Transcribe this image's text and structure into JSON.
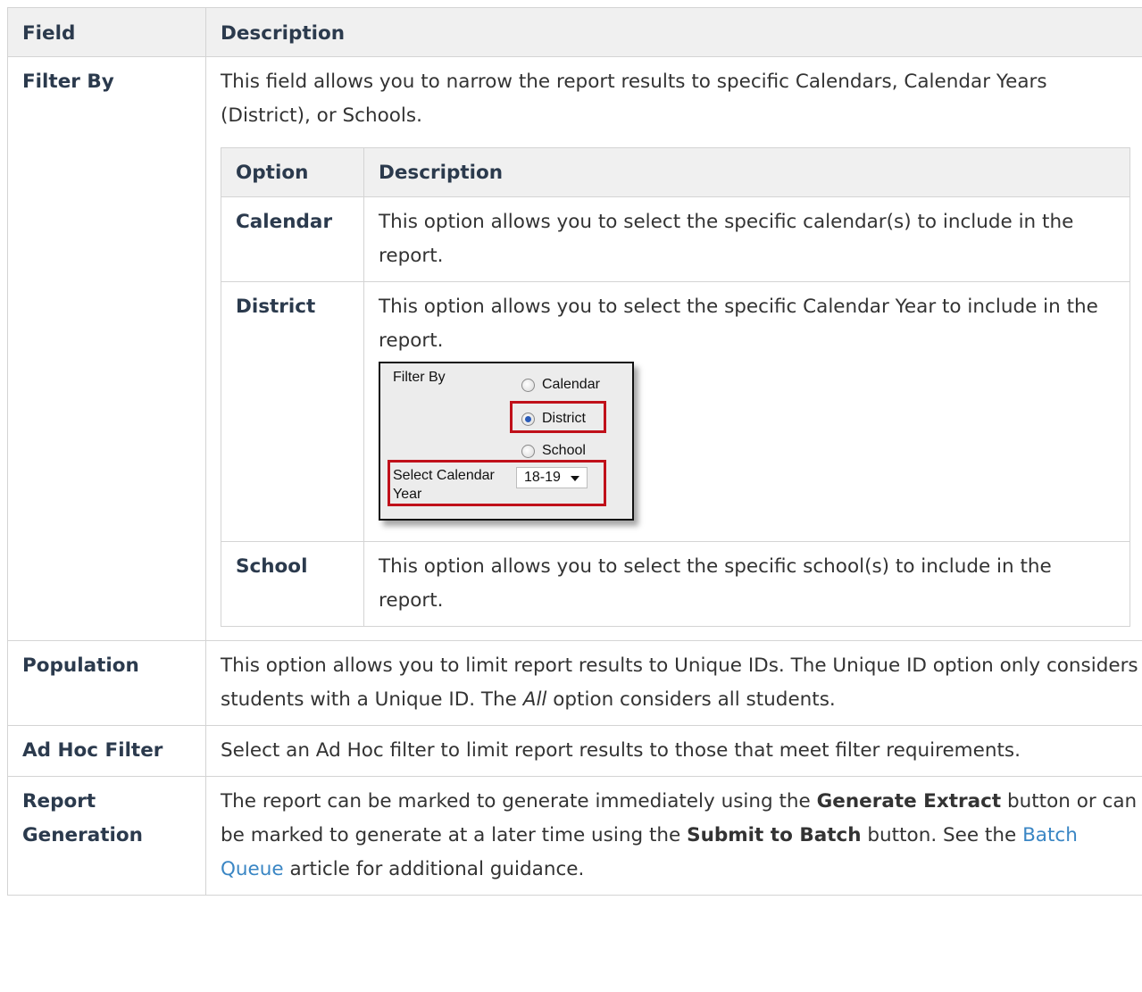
{
  "table": {
    "header": {
      "field": "Field",
      "description": "Description"
    },
    "filter_by": {
      "field": "Filter By",
      "description": "This field allows you to narrow the report results to specific Calendars, Calendar Years (District), or Schools.",
      "options_header": {
        "option": "Option",
        "description": "Description"
      },
      "calendar": {
        "option": "Calendar",
        "description": "This option allows you to select the specific calendar(s) to include in the report."
      },
      "district": {
        "option": "District",
        "description": "This option allows you to select the specific Calendar Year to include in the report."
      },
      "school": {
        "option": "School",
        "description": "This option allows you to select the specific school(s) to include in the report."
      }
    },
    "population": {
      "field": "Population",
      "text_1": "This option allows you to limit report results to Unique IDs. The Unique ID option only considers students with a Unique ID. The ",
      "text_em": "All",
      "text_2": " option considers all students."
    },
    "ad_hoc": {
      "field": "Ad Hoc Filter",
      "description": "Select an Ad Hoc filter to limit report results to those that meet filter requirements."
    },
    "report_generation": {
      "field_line1": "Report",
      "field_line2": "Generation",
      "text_1": "The report can be marked to generate immediately using the ",
      "bold_1": "Generate Extract",
      "text_2": " button or can be marked to generate at a later time using the ",
      "bold_2": "Submit to Batch",
      "text_3": " button. See the ",
      "link": "Batch Queue",
      "text_4": " article for additional guidance."
    }
  },
  "screenshot": {
    "filter_label": "Filter By",
    "radio_calendar": "Calendar",
    "radio_district": "District",
    "radio_school": "School",
    "select_label_line1": "Select Calendar",
    "select_label_line2": "Year",
    "select_value": "18-19",
    "selected_option": "District",
    "highlight_color": "#c0101a"
  },
  "colors": {
    "heading": "#2b3a4d",
    "body_text": "#333333",
    "link": "#3a86c4",
    "header_bg": "#f0f0f0",
    "border": "#d4d4d4"
  }
}
